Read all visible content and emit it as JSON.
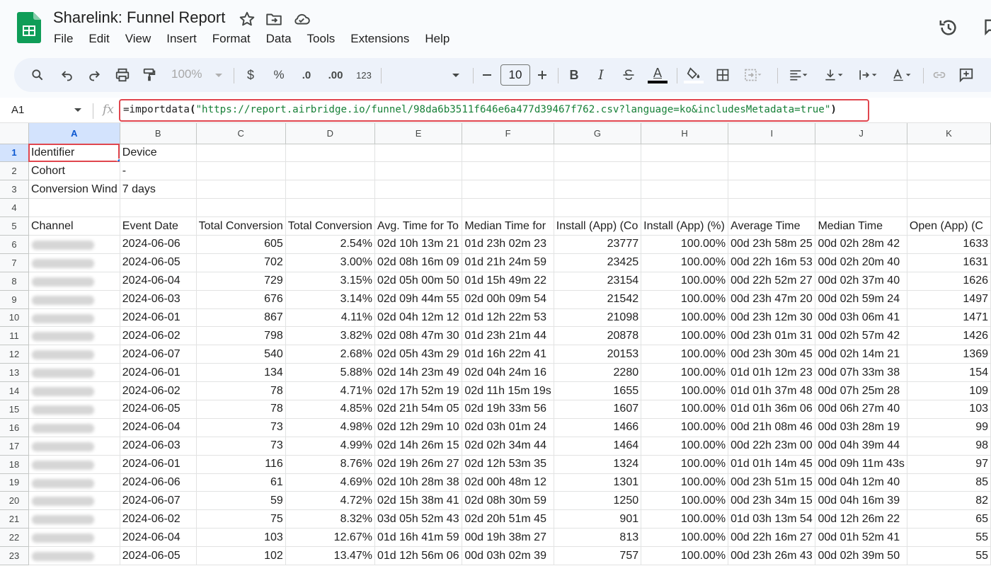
{
  "doc": {
    "title": "Sharelink: Funnel Report",
    "menu": [
      "File",
      "Edit",
      "View",
      "Insert",
      "Format",
      "Data",
      "Tools",
      "Extensions",
      "Help"
    ]
  },
  "toolbar": {
    "zoom": "100%",
    "currency": "$",
    "percent": "%",
    "dec_decrease": ".0",
    "dec_increase": ".00",
    "number_format": "123",
    "font_size": "10",
    "bold": "B",
    "italic": "I",
    "text_color_letter": "A"
  },
  "formula_bar": {
    "cell_ref": "A1",
    "fx": "fx",
    "func": "=importdata",
    "open": "(",
    "arg": "\"https://report.airbridge.io/funnel/98da6b3511f646e6a477d39467f762.csv?language=ko&includesMetadata=true\"",
    "close": ")"
  },
  "grid": {
    "columns": [
      "A",
      "B",
      "C",
      "D",
      "E",
      "F",
      "G",
      "H",
      "I",
      "J",
      "K"
    ],
    "rows": [
      {
        "n": "1",
        "cells": [
          "Identifier",
          "Device",
          "",
          "",
          "",
          "",
          "",
          "",
          "",
          "",
          ""
        ]
      },
      {
        "n": "2",
        "cells": [
          "Cohort",
          "-",
          "",
          "",
          "",
          "",
          "",
          "",
          "",
          "",
          ""
        ]
      },
      {
        "n": "3",
        "cells": [
          "Conversion Wind",
          "7 days",
          "",
          "",
          "",
          "",
          "",
          "",
          "",
          "",
          ""
        ]
      },
      {
        "n": "4",
        "cells": [
          "",
          "",
          "",
          "",
          "",
          "",
          "",
          "",
          "",
          "",
          ""
        ]
      },
      {
        "n": "5",
        "cells": [
          "Channel",
          "Event Date",
          "Total Conversion",
          "Total Conversion",
          "Avg. Time for To",
          "Median Time for",
          "Install (App) (Co",
          "Install (App) (%)",
          "Average Time",
          "Median Time",
          "Open (App) (C"
        ]
      },
      {
        "n": "6",
        "cells": [
          "",
          "2024-06-06",
          "605",
          "2.54%",
          "02d 10h 13m 21",
          "01d 23h 02m 23",
          "23777",
          "100.00%",
          "00d 23h 58m 25",
          "00d 02h 28m 42",
          "1633"
        ]
      },
      {
        "n": "7",
        "cells": [
          "",
          "2024-06-05",
          "702",
          "3.00%",
          "02d 08h 16m 09",
          "01d 21h 24m 59",
          "23425",
          "100.00%",
          "00d 22h 16m 53",
          "00d 02h 20m 40",
          "1631"
        ]
      },
      {
        "n": "8",
        "cells": [
          "",
          "2024-06-04",
          "729",
          "3.15%",
          "02d 05h 00m 50",
          "01d 15h 49m 22",
          "23154",
          "100.00%",
          "00d 22h 52m 27",
          "00d 02h 37m 40",
          "1626"
        ]
      },
      {
        "n": "9",
        "cells": [
          "",
          "2024-06-03",
          "676",
          "3.14%",
          "02d 09h 44m 55",
          "02d 00h 09m 54",
          "21542",
          "100.00%",
          "00d 23h 47m 20",
          "00d 02h 59m 24",
          "1497"
        ]
      },
      {
        "n": "10",
        "cells": [
          "",
          "2024-06-01",
          "867",
          "4.11%",
          "02d 04h 12m 12",
          "01d 12h 22m 53",
          "21098",
          "100.00%",
          "00d 23h 12m 30",
          "00d 03h 06m 41",
          "1471"
        ]
      },
      {
        "n": "11",
        "cells": [
          "",
          "2024-06-02",
          "798",
          "3.82%",
          "02d 08h 47m 30",
          "01d 23h 21m 44",
          "20878",
          "100.00%",
          "00d 23h 01m 31",
          "00d 02h 57m 42",
          "1426"
        ]
      },
      {
        "n": "12",
        "cells": [
          "",
          "2024-06-07",
          "540",
          "2.68%",
          "02d 05h 43m 29",
          "01d 16h 22m 41",
          "20153",
          "100.00%",
          "00d 23h 30m 45",
          "00d 02h 14m 21",
          "1369"
        ]
      },
      {
        "n": "13",
        "cells": [
          "",
          "2024-06-01",
          "134",
          "5.88%",
          "02d 14h 23m 49",
          "02d 04h 24m 16",
          "2280",
          "100.00%",
          "01d 01h 12m 23",
          "00d 07h 33m 38",
          "154"
        ]
      },
      {
        "n": "14",
        "cells": [
          "",
          "2024-06-02",
          "78",
          "4.71%",
          "02d 17h 52m 19",
          "02d 11h 15m 19s",
          "1655",
          "100.00%",
          "01d 01h 37m 48",
          "00d 07h 25m 28",
          "109"
        ]
      },
      {
        "n": "15",
        "cells": [
          "",
          "2024-06-05",
          "78",
          "4.85%",
          "02d 21h 54m 05",
          "02d 19h 33m 56",
          "1607",
          "100.00%",
          "01d 01h 36m 06",
          "00d 06h 27m 40",
          "103"
        ]
      },
      {
        "n": "16",
        "cells": [
          "",
          "2024-06-04",
          "73",
          "4.98%",
          "02d 12h 29m 10",
          "02d 03h 01m 24",
          "1466",
          "100.00%",
          "00d 21h 08m 46",
          "00d 03h 28m 19",
          "99"
        ]
      },
      {
        "n": "17",
        "cells": [
          "",
          "2024-06-03",
          "73",
          "4.99%",
          "02d 14h 26m 15",
          "02d 02h 34m 44",
          "1464",
          "100.00%",
          "00d 22h 23m 00",
          "00d 04h 39m 44",
          "98"
        ]
      },
      {
        "n": "18",
        "cells": [
          "",
          "2024-06-01",
          "116",
          "8.76%",
          "02d 19h 26m 27",
          "02d 12h 53m 35",
          "1324",
          "100.00%",
          "01d 01h 14m 45",
          "00d 09h 11m 43s",
          "97"
        ]
      },
      {
        "n": "19",
        "cells": [
          "",
          "2024-06-06",
          "61",
          "4.69%",
          "02d 10h 28m 38",
          "02d 00h 48m 12",
          "1301",
          "100.00%",
          "00d 23h 51m 15",
          "00d 04h 12m 40",
          "85"
        ]
      },
      {
        "n": "20",
        "cells": [
          "",
          "2024-06-07",
          "59",
          "4.72%",
          "02d 15h 38m 41",
          "02d 08h 30m 59",
          "1250",
          "100.00%",
          "00d 23h 34m 15",
          "00d 04h 16m 39",
          "82"
        ]
      },
      {
        "n": "21",
        "cells": [
          "",
          "2024-06-02",
          "75",
          "8.32%",
          "03d 05h 52m 43",
          "02d 20h 51m 45",
          "901",
          "100.00%",
          "01d 03h 13m 54",
          "00d 12h 26m 22",
          "65"
        ]
      },
      {
        "n": "22",
        "cells": [
          "",
          "2024-06-04",
          "103",
          "12.67%",
          "01d 16h 41m 59",
          "00d 19h 38m 27",
          "813",
          "100.00%",
          "00d 22h 16m 27",
          "00d 01h 52m 41",
          "55"
        ]
      },
      {
        "n": "23",
        "cells": [
          "",
          "2024-06-05",
          "102",
          "13.47%",
          "01d 12h 56m 06",
          "00d 03h 02m 39",
          "757",
          "100.00%",
          "00d 23h 26m 43",
          "00d 02h 39m 50",
          "55"
        ]
      }
    ]
  },
  "icons": {
    "star": "star-icon",
    "move": "move-to-folder-icon",
    "cloud": "cloud-saved-icon",
    "history": "version-history-icon",
    "search": "search-icon",
    "undo": "undo-icon",
    "redo": "redo-icon",
    "print": "print-icon",
    "paint_format": "paint-format-icon"
  },
  "colors": {
    "accent_red": "#e0464e",
    "selection_blue": "#d3e3fd",
    "string_green": "#188038",
    "sheets_green": "#0f9d58"
  }
}
